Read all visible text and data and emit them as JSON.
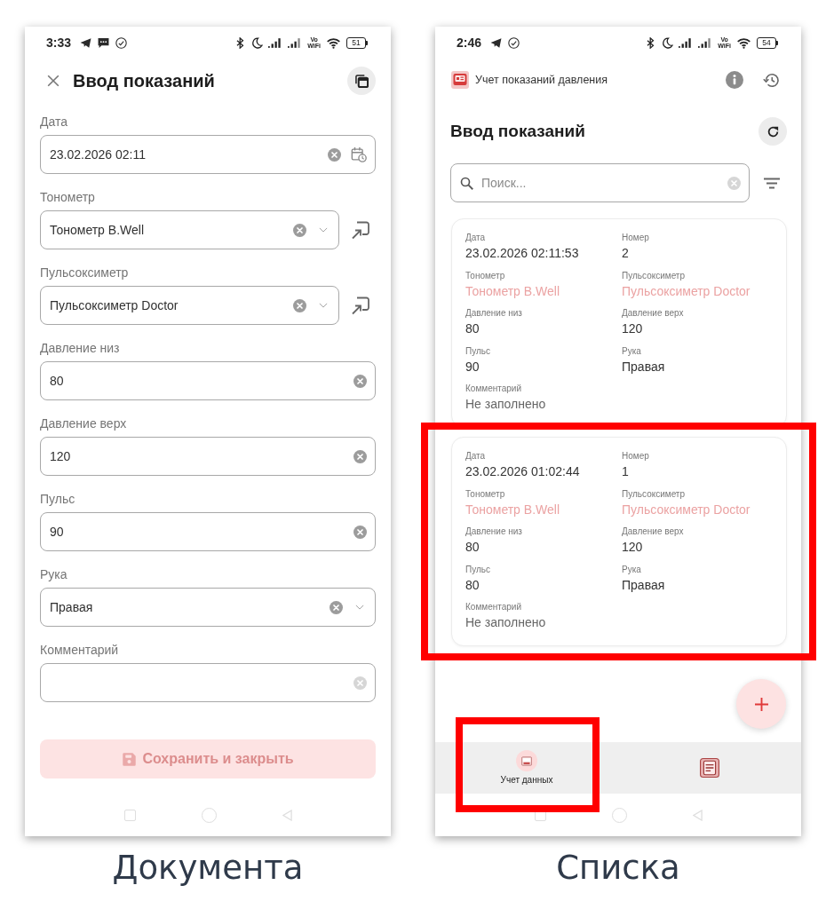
{
  "screens": [
    {
      "kind": "form",
      "status_bar": {
        "time": "3:33",
        "notifications": [
          {
            "kind": "send"
          },
          {
            "kind": "chat"
          },
          {
            "kind": "check"
          }
        ],
        "vowifi": [
          "Vo",
          "WiFi"
        ],
        "battery": "51"
      },
      "header": {
        "title": "Ввод показаний"
      },
      "fields": [
        {
          "kind": "date",
          "label": "Дата",
          "value": "23.02.2026 02:11"
        },
        {
          "kind": "reference",
          "label": "Тонометр",
          "value": "Тонометр B.Well"
        },
        {
          "kind": "reference",
          "label": "Пульсоксиметр",
          "value": "Пульсоксиметр Doctor"
        },
        {
          "kind": "text",
          "label": "Давление низ",
          "value": "80"
        },
        {
          "kind": "text",
          "label": "Давление верх",
          "value": "120"
        },
        {
          "kind": "text",
          "label": "Пульс",
          "value": "90"
        },
        {
          "kind": "choice",
          "label": "Рука",
          "value": "Правая"
        },
        {
          "kind": "text",
          "label": "Комментарий"
        }
      ],
      "save_button": {
        "label": "Сохранить и закрыть",
        "disabled": true
      },
      "caption": "Документа"
    },
    {
      "kind": "list",
      "status_bar": {
        "time": "2:46",
        "notifications": [
          {
            "kind": "send"
          },
          {
            "kind": "check"
          }
        ],
        "vowifi": [
          "Vo",
          "WiFi"
        ],
        "battery": "54"
      },
      "app_bar": {
        "title": "Учет показаний давления"
      },
      "header": {
        "title": "Ввод показаний"
      },
      "search": {
        "placeholder": "Поиск..."
      },
      "cards": [
        {
          "highlighted": false,
          "fields": [
            {
              "kind": "text",
              "label": "Дата",
              "value": "23.02.2026 02:11:53"
            },
            {
              "kind": "text",
              "label": "Номер",
              "value": "2"
            },
            {
              "kind": "link",
              "label": "Тонометр",
              "value": "Тонометр B.Well"
            },
            {
              "kind": "link",
              "label": "Пульсоксиметр",
              "value": "Пульсоксиметр Doctor"
            },
            {
              "kind": "text",
              "label": "Давление низ",
              "value": "80"
            },
            {
              "kind": "text",
              "label": "Давление верх",
              "value": "120"
            },
            {
              "kind": "text",
              "label": "Пульс",
              "value": "90"
            },
            {
              "kind": "text",
              "label": "Рука",
              "value": "Правая"
            },
            {
              "kind": "empty",
              "label": "Комментарий",
              "value": "Не заполнено"
            }
          ]
        },
        {
          "highlighted": true,
          "fields": [
            {
              "kind": "text",
              "label": "Дата",
              "value": "23.02.2026 01:02:44"
            },
            {
              "kind": "text",
              "label": "Номер",
              "value": "1"
            },
            {
              "kind": "link",
              "label": "Тонометр",
              "value": "Тонометр B.Well"
            },
            {
              "kind": "link",
              "label": "Пульсоксиметр",
              "value": "Пульсоксиметр Doctor"
            },
            {
              "kind": "text",
              "label": "Давление низ",
              "value": "80"
            },
            {
              "kind": "text",
              "label": "Давление верх",
              "value": "120"
            },
            {
              "kind": "text",
              "label": "Пульс",
              "value": "80"
            },
            {
              "kind": "text",
              "label": "Рука",
              "value": "Правая"
            },
            {
              "kind": "empty",
              "label": "Комментарий",
              "value": "Не заполнено"
            }
          ]
        }
      ],
      "bottom_nav": [
        {
          "kind": "monitor",
          "label": "Учет данных",
          "selected": true,
          "highlighted": true
        },
        {
          "kind": "document",
          "selected": false,
          "highlighted": false
        }
      ],
      "caption": "Списка"
    }
  ]
}
